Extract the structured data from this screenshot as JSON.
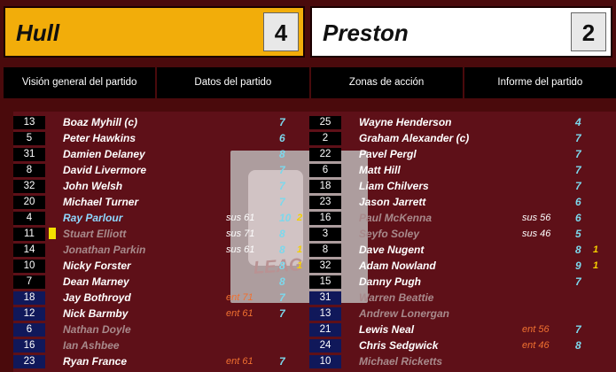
{
  "home": {
    "name": "Hull",
    "score": "4"
  },
  "away": {
    "name": "Preston",
    "score": "2"
  },
  "tabs": [
    "Visión general del partido",
    "Datos del partido",
    "Zonas de acción",
    "Informe del partido"
  ],
  "home_players": [
    {
      "num": "13",
      "name": "Boaz Myhill (c)",
      "rating": "7"
    },
    {
      "num": "5",
      "name": "Peter Hawkins",
      "rating": "6"
    },
    {
      "num": "31",
      "name": "Damien Delaney",
      "rating": "8"
    },
    {
      "num": "8",
      "name": "David Livermore",
      "rating": "7"
    },
    {
      "num": "32",
      "name": "John Welsh",
      "rating": "7"
    },
    {
      "num": "20",
      "name": "Michael Turner",
      "rating": "7"
    },
    {
      "num": "4",
      "name": "Ray Parlour",
      "event": "sus 61",
      "rating": "10",
      "goals": "2",
      "style": "hl"
    },
    {
      "num": "11",
      "name": "Stuart Elliott",
      "event": "sus 71",
      "rating": "8",
      "card": true,
      "style": "dim"
    },
    {
      "num": "14",
      "name": "Jonathan Parkin",
      "event": "sus 61",
      "rating": "8",
      "goals": "1",
      "style": "dim"
    },
    {
      "num": "10",
      "name": "Nicky Forster",
      "rating": "8",
      "goals": "1"
    },
    {
      "num": "7",
      "name": "Dean Marney",
      "rating": "8"
    },
    {
      "num": "18",
      "name": "Jay Bothroyd",
      "event": "ent 71",
      "event_type": "in",
      "rating": "7",
      "sub": true
    },
    {
      "num": "12",
      "name": "Nick Barmby",
      "event": "ent 61",
      "event_type": "in",
      "rating": "7",
      "sub": true
    },
    {
      "num": "6",
      "name": "Nathan Doyle",
      "sub": true,
      "style": "dim"
    },
    {
      "num": "16",
      "name": "Ian Ashbee",
      "sub": true,
      "style": "dim"
    },
    {
      "num": "23",
      "name": "Ryan France",
      "event": "ent 61",
      "event_type": "in",
      "rating": "7",
      "sub": true
    }
  ],
  "away_players": [
    {
      "num": "25",
      "name": "Wayne Henderson",
      "rating": "4"
    },
    {
      "num": "2",
      "name": "Graham Alexander (c)",
      "rating": "7"
    },
    {
      "num": "22",
      "name": "Pavel Pergl",
      "rating": "7"
    },
    {
      "num": "6",
      "name": "Matt Hill",
      "rating": "7"
    },
    {
      "num": "18",
      "name": "Liam Chilvers",
      "rating": "7"
    },
    {
      "num": "23",
      "name": "Jason Jarrett",
      "rating": "6"
    },
    {
      "num": "16",
      "name": "Paul McKenna",
      "event": "sus 56",
      "rating": "6",
      "style": "dim"
    },
    {
      "num": "3",
      "name": "Seyfo Soley",
      "event": "sus 46",
      "rating": "5",
      "style": "dim"
    },
    {
      "num": "8",
      "name": "Dave Nugent",
      "rating": "8",
      "goals": "1"
    },
    {
      "num": "32",
      "name": "Adam Nowland",
      "rating": "9",
      "goals": "1"
    },
    {
      "num": "15",
      "name": "Danny Pugh",
      "rating": "7"
    },
    {
      "num": "31",
      "name": "Warren Beattie",
      "sub": true,
      "style": "dim"
    },
    {
      "num": "13",
      "name": "Andrew Lonergan",
      "sub": true,
      "style": "dim"
    },
    {
      "num": "21",
      "name": "Lewis Neal",
      "event": "ent 56",
      "event_type": "in",
      "rating": "7",
      "sub": true
    },
    {
      "num": "24",
      "name": "Chris Sedgwick",
      "event": "ent 46",
      "event_type": "in",
      "rating": "8",
      "sub": true
    },
    {
      "num": "10",
      "name": "Michael Ricketts",
      "sub": true,
      "style": "dim"
    }
  ],
  "watermark": {
    "text": "Coca-Cola LEAGUE",
    "visible_fragments": [
      "Coca",
      "LEAG"
    ]
  }
}
